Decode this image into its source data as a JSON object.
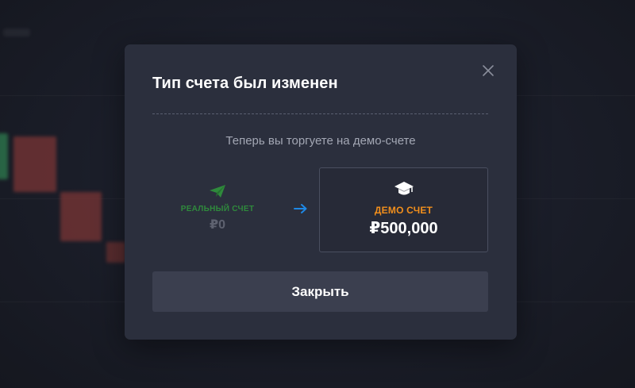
{
  "modal": {
    "title": "Тип счета был изменен",
    "subtitle": "Теперь вы торгуете на демо-счете",
    "close_icon": "close-icon",
    "real_account": {
      "icon": "paper-plane-icon",
      "label": "РЕАЛЬНЫЙ СЧЕТ",
      "balance": "₽0"
    },
    "arrow_icon": "arrow-right-icon",
    "demo_account": {
      "icon": "graduation-cap-icon",
      "label": "ДЕМО СЧЕТ",
      "balance": "₽500,000"
    },
    "close_button_label": "Закрыть"
  },
  "colors": {
    "modal_background": "#2b2f3d",
    "real_account_green": "#2f8a3c",
    "demo_account_orange": "#f28f1c",
    "arrow_blue": "#1e88e5",
    "button_background": "#3b3f4f"
  }
}
